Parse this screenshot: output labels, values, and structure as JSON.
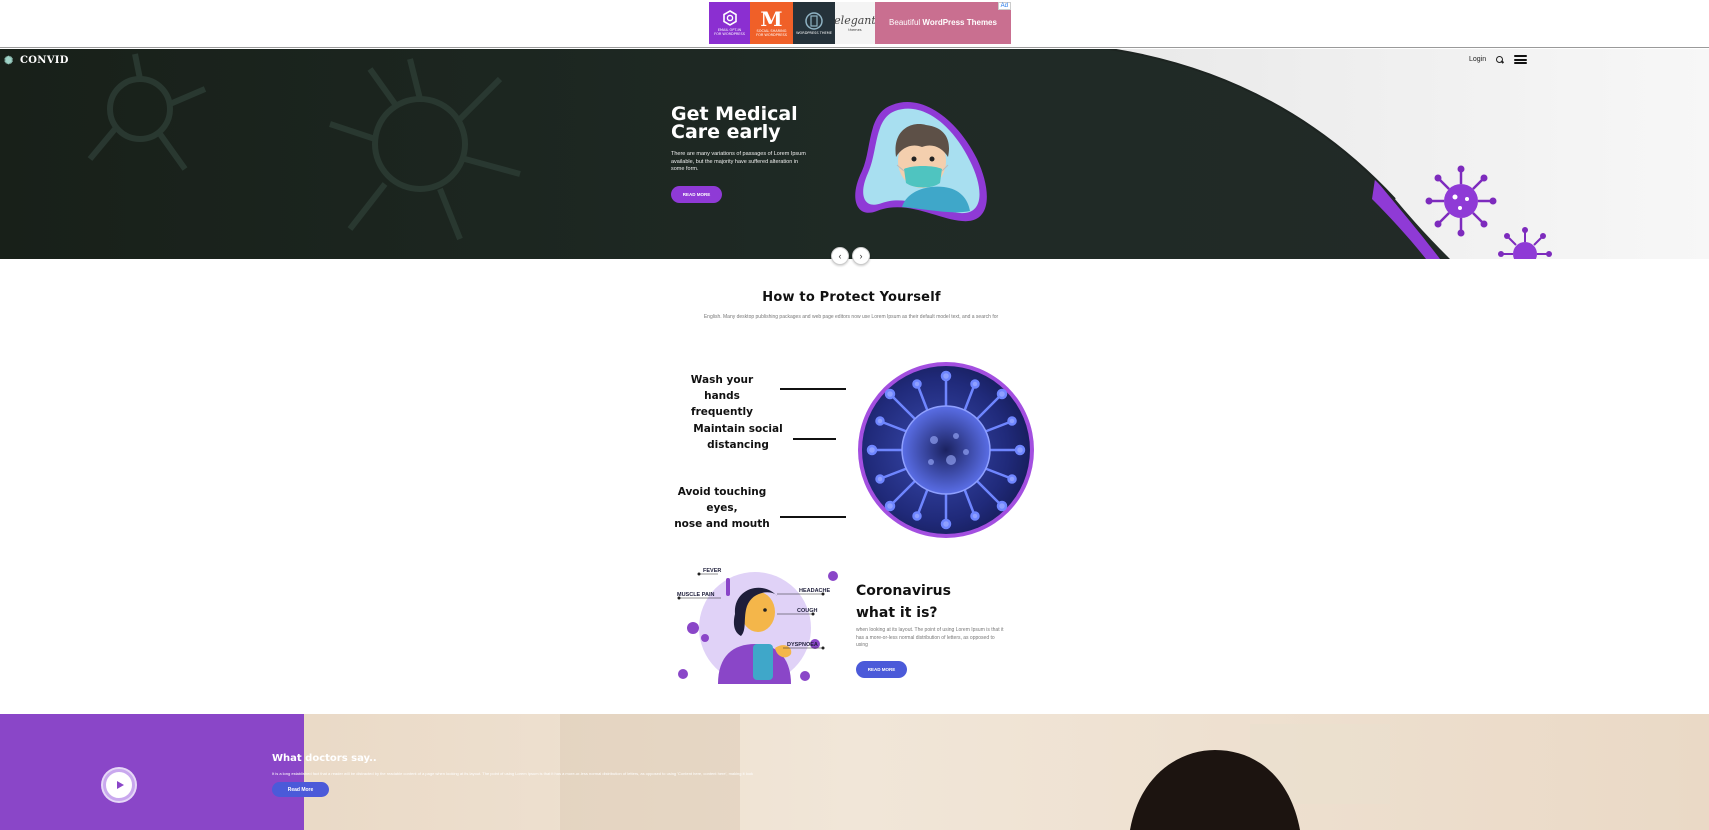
{
  "ad": {
    "tiles": [
      {
        "label": "EMAIL OPT-IN\nFOR WORDPRESS"
      },
      {
        "logo": "M",
        "label": "SOCIAL SHARING\nFOR WORDPRESS"
      },
      {
        "label": "WORDPRESS THEME"
      },
      {
        "logo": "elegant",
        "label": "themes"
      },
      {
        "prefix": "Beautiful",
        "emphasis": "WordPress Themes"
      }
    ],
    "mark": "Ad"
  },
  "nav": {
    "brand": "CONVID",
    "login": "Login"
  },
  "hero": {
    "title_line1": "Get Medical",
    "title_line2": "Care early",
    "text": "There are many variations of passages of Lorem Ipsum available, but the majority have suffered alteration in some form.",
    "button": "READ MORE"
  },
  "slider": {
    "prev": "‹",
    "next": "›"
  },
  "protect": {
    "title": "How to Protect Yourself",
    "subtitle": "English. Many desktop publishing packages and web page editors now use Lorem Ipsum as their default model text, and a search for",
    "tips": [
      {
        "line1": "Wash your",
        "line2": "hands frequently"
      },
      {
        "line1": "Maintain social",
        "line2": "distancing"
      },
      {
        "line1": "Avoid touching",
        "line2": "eyes,",
        "line3": "nose and mouth"
      }
    ]
  },
  "symptoms": {
    "labels": [
      "FEVER",
      "MUSCLE PAIN",
      "HEADACHE",
      "COUGH",
      "DYSPNOEA"
    ]
  },
  "corona": {
    "title_line1": "Coronavirus",
    "title_line2": "what it is?",
    "text": "when looking at its layout. The point of using Lorem Ipsum is that it has a more-or-less normal distribution of letters, as opposed to using",
    "button": "READ MORE"
  },
  "doctors": {
    "title": "What doctors say..",
    "text": "It is a long established fact that a reader will be distracted by the readable content of a page when looking at its layout. The point of using Lorem Ipsum is that it has a more-or-less normal distribution of letters, as opposed to using 'Content here, content here', making it look",
    "button": "Read More"
  },
  "colors": {
    "accent_purple": "#8f3ad6",
    "accent_blue": "#4b5ad9",
    "hero_dark": "#1d2421"
  }
}
